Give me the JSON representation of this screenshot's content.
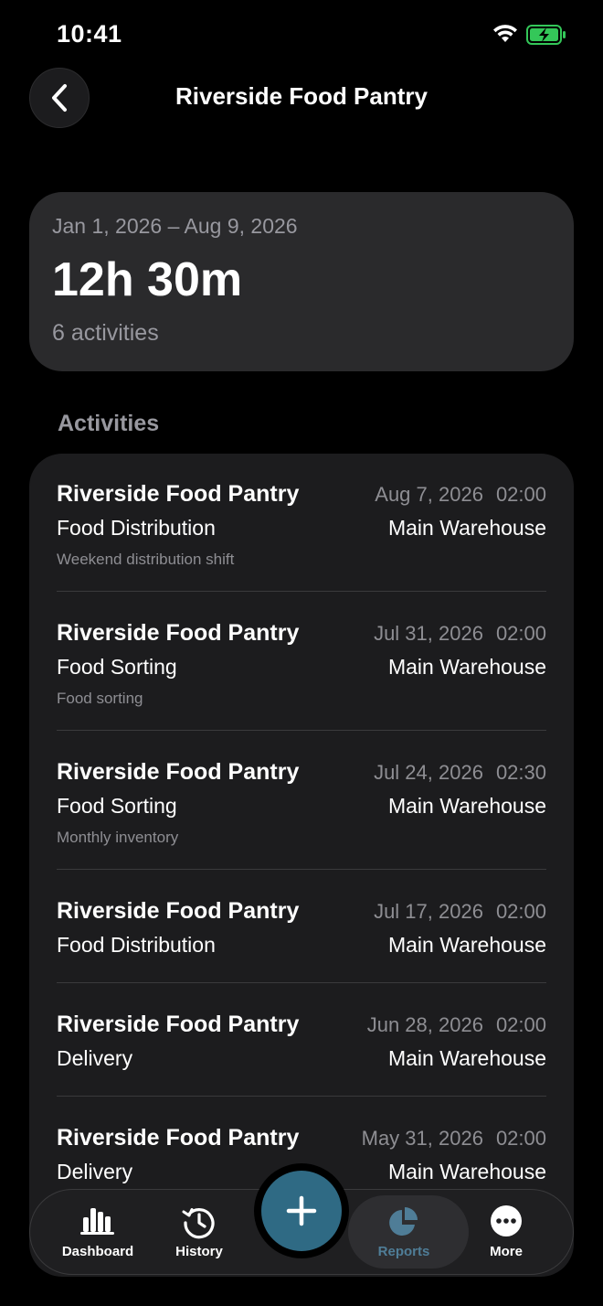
{
  "status_bar": {
    "time": "10:41"
  },
  "nav": {
    "title": "Riverside Food Pantry"
  },
  "summary": {
    "date_range": "Jan 1, 2026 – Aug 9, 2026",
    "total_time": "12h 30m",
    "activity_count": "6 activities"
  },
  "activities_header": "Activities",
  "activities": [
    {
      "org": "Riverside Food Pantry",
      "type": "Food Distribution",
      "note": "Weekend distribution shift",
      "date": "Aug 7, 2026",
      "duration": "02:00",
      "location": "Main Warehouse"
    },
    {
      "org": "Riverside Food Pantry",
      "type": "Food Sorting",
      "note": "Food sorting",
      "date": "Jul 31, 2026",
      "duration": "02:00",
      "location": "Main Warehouse"
    },
    {
      "org": "Riverside Food Pantry",
      "type": "Food Sorting",
      "note": "Monthly inventory",
      "date": "Jul 24, 2026",
      "duration": "02:30",
      "location": "Main Warehouse"
    },
    {
      "org": "Riverside Food Pantry",
      "type": "Food Distribution",
      "note": "",
      "date": "Jul 17, 2026",
      "duration": "02:00",
      "location": "Main Warehouse"
    },
    {
      "org": "Riverside Food Pantry",
      "type": "Delivery",
      "note": "",
      "date": "Jun 28, 2026",
      "duration": "02:00",
      "location": "Main Warehouse"
    },
    {
      "org": "Riverside Food Pantry",
      "type": "Delivery",
      "note": "",
      "date": "May 31, 2026",
      "duration": "02:00",
      "location": "Main Warehouse"
    }
  ],
  "tabs": [
    {
      "label": "Dashboard",
      "icon": "bar-chart-icon"
    },
    {
      "label": "History",
      "icon": "history-icon"
    },
    {
      "label": "Reports",
      "icon": "pie-chart-icon",
      "active": true
    },
    {
      "label": "More",
      "icon": "more-icon"
    }
  ],
  "colors": {
    "accent": "#2f6a84",
    "active_tab": "#4f7d97",
    "battery": "#34c759"
  }
}
